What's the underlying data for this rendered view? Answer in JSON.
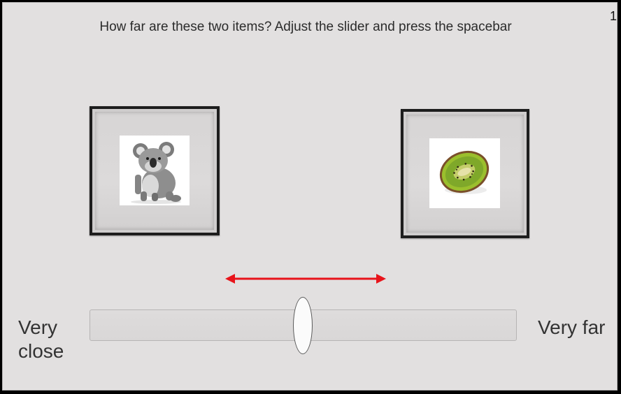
{
  "trial": {
    "number": "1"
  },
  "instruction": "How far are these two items? Adjust the slider and press the spacebar",
  "items": {
    "left": {
      "icon": "koala"
    },
    "right": {
      "icon": "kiwi-slice"
    }
  },
  "slider": {
    "label_min": "Very\nclose",
    "label_max": "Very far",
    "value_fraction": 0.5,
    "hint_icon": "double-headed-arrow",
    "hint_color": "#e8141b"
  }
}
